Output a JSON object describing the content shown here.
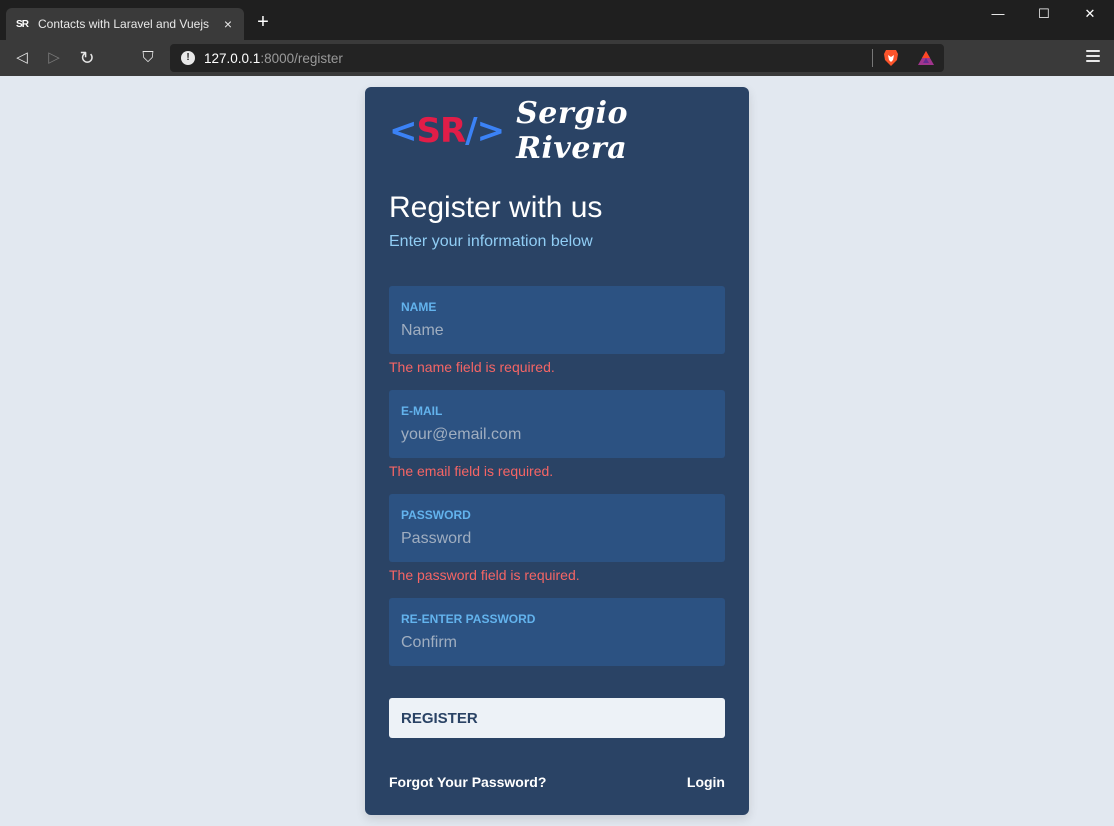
{
  "browser": {
    "tab_favicon": "SR",
    "tab_title": "Contacts with Laravel and Vuejs",
    "tab_close": "×",
    "new_tab": "+",
    "window_controls": {
      "minimize": "—",
      "maximize": "☐",
      "close": "✕"
    },
    "nav": {
      "back": "◁",
      "forward": "▷",
      "reload": "↻",
      "bookmark": "⛉"
    },
    "url_host": "127.0.0.1",
    "url_rest": ":8000/register",
    "icons": [
      "info-icon",
      "brave-shield-icon",
      "brave-rewards-icon",
      "hamburger-menu-icon"
    ]
  },
  "logo": {
    "open": "<",
    "mark": "SR",
    "slash_close": "/>",
    "name": "Sergio Rivera"
  },
  "form": {
    "title": "Register with us",
    "subtitle": "Enter your information below",
    "fields": [
      {
        "label": "NAME",
        "placeholder": "Name",
        "value": "",
        "error": "The name field is required."
      },
      {
        "label": "E-MAIL",
        "placeholder": "your@email.com",
        "value": "",
        "error": "The email field is required."
      },
      {
        "label": "PASSWORD",
        "placeholder": "Password",
        "value": "",
        "error": "The password field is required."
      },
      {
        "label": "RE-ENTER PASSWORD",
        "placeholder": "Confirm",
        "value": ""
      }
    ],
    "submit_label": "REGISTER",
    "forgot_link": "Forgot Your Password?",
    "login_link": "Login"
  },
  "colors": {
    "page_bg": "#e2e8f0",
    "card_bg": "#2a4365",
    "field_bg": "#2c5282",
    "label": "#63b3ed",
    "subtitle": "#90cdf4",
    "error": "#f56565",
    "logo_brackets": "#3b82f6",
    "logo_mark": "#e11d48"
  }
}
